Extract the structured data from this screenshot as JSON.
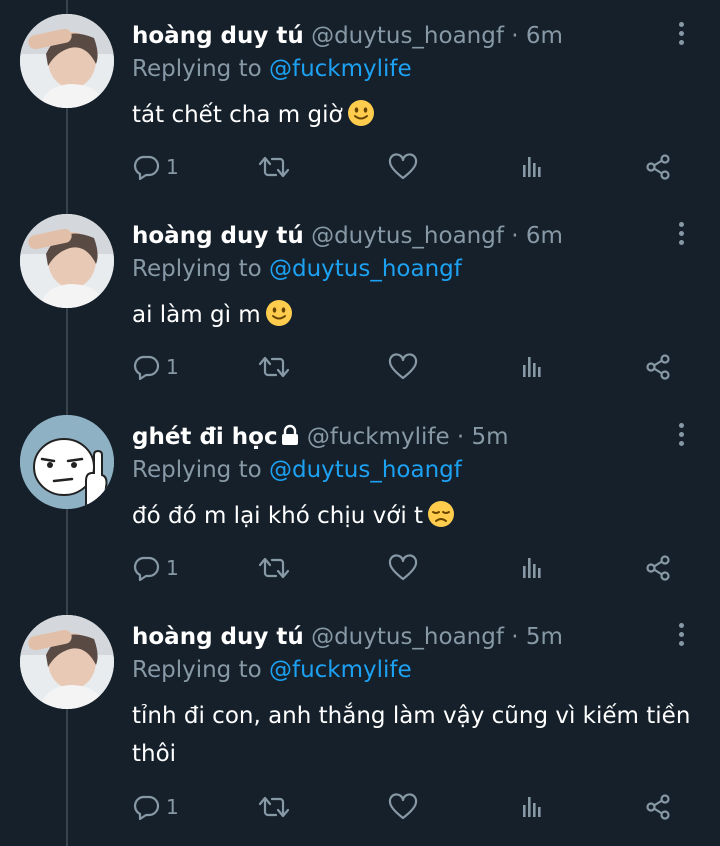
{
  "tweets": [
    {
      "name": "hoàng duy tú",
      "handle": "@duytus_hoangf",
      "dot": "·",
      "time": "6m",
      "replying_prefix": "Replying to",
      "replying_to": "@fuckmylife",
      "text": "tát chết cha m giờ",
      "emoji": "slightly-smiling-face",
      "reply_count": "1",
      "avatar": "person-photo"
    },
    {
      "name": "hoàng duy tú",
      "handle": "@duytus_hoangf",
      "dot": "·",
      "time": "6m",
      "replying_prefix": "Replying to",
      "replying_to": "@duytus_hoangf",
      "text": "ai làm gì m",
      "emoji": "slightly-smiling-face",
      "reply_count": "1",
      "avatar": "person-photo"
    },
    {
      "name": "ghét đi học",
      "handle": "@fuckmylife",
      "dot": "·",
      "time": "5m",
      "replying_prefix": "Replying to",
      "replying_to": "@duytus_hoangf",
      "text": "đó đó m lại khó chịu với t",
      "emoji": "disappointed-face",
      "reply_count": "1",
      "protected": true,
      "avatar": "meme-face"
    },
    {
      "name": "hoàng duy tú",
      "handle": "@duytus_hoangf",
      "dot": "·",
      "time": "5m",
      "replying_prefix": "Replying to",
      "replying_to": "@fuckmylife",
      "text": "tỉnh đi con, anh thắng làm vậy cũng vì kiếm tiền thôi",
      "reply_count": "1",
      "avatar": "person-photo"
    }
  ],
  "colors": {
    "background": "#15202b",
    "text": "#ffffff",
    "secondary": "#8899a6",
    "mention": "#1da1f2",
    "thread_line": "#38444d"
  },
  "icons": [
    "reply-icon",
    "retweet-icon",
    "like-icon",
    "analytics-icon",
    "share-icon",
    "more-icon",
    "lock-icon"
  ]
}
